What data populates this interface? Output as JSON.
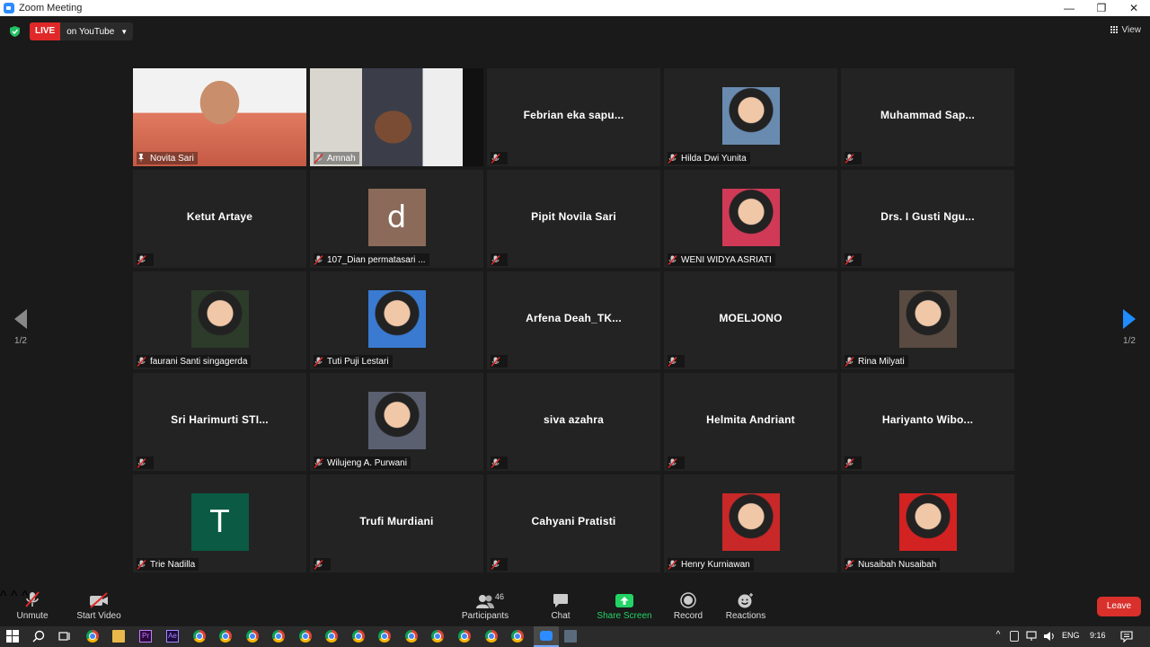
{
  "window": {
    "title": "Zoom Meeting"
  },
  "top": {
    "live_label": "LIVE",
    "live_target": "on YouTube",
    "view_label": "View"
  },
  "pagination": {
    "left": "1/2",
    "right": "1/2"
  },
  "tiles": [
    {
      "name": "Novita Sari",
      "display": "video",
      "active": true,
      "pinned": true
    },
    {
      "name": "Amnah",
      "display": "video"
    },
    {
      "name": "",
      "display": "name",
      "center_name": "Febrian  eka  sapu..."
    },
    {
      "name": "Hilda Dwi Yunita",
      "display": "photo"
    },
    {
      "name": "",
      "display": "name",
      "center_name": "Muhammad  Sap..."
    },
    {
      "name": "",
      "display": "name",
      "center_name": "Ketut Artaye"
    },
    {
      "name": "107_Dian permatasari ...",
      "display": "initial",
      "initial": "d",
      "initial_color": "#8b6a5a"
    },
    {
      "name": "",
      "display": "name",
      "center_name": "Pipit Novila Sari"
    },
    {
      "name": "WENI WIDYA ASRIATI",
      "display": "photo"
    },
    {
      "name": "",
      "display": "name",
      "center_name": "Drs.  I Gusti Ngu..."
    },
    {
      "name": "faurani Santi singagerda",
      "display": "photo"
    },
    {
      "name": "Tuti Puji Lestari",
      "display": "photo"
    },
    {
      "name": "",
      "display": "name",
      "center_name": "Arfena  Deah_TK..."
    },
    {
      "name": "",
      "display": "name",
      "center_name": "MOELJONO"
    },
    {
      "name": "Rina Milyati",
      "display": "photo"
    },
    {
      "name": "",
      "display": "name",
      "center_name": "Sri  Harimurti  STI..."
    },
    {
      "name": "Wilujeng A. Purwani",
      "display": "photo"
    },
    {
      "name": "",
      "display": "name",
      "center_name": "siva azahra"
    },
    {
      "name": "",
      "display": "name",
      "center_name": "Helmita Andriant"
    },
    {
      "name": "",
      "display": "name",
      "center_name": "Hariyanto  Wibo..."
    },
    {
      "name": "Trie Nadilla",
      "display": "initial",
      "initial": "T",
      "initial_color": "#0b5a43"
    },
    {
      "name": "",
      "display": "name",
      "center_name": "Trufi Murdiani"
    },
    {
      "name": "",
      "display": "name",
      "center_name": "Cahyani Pratisti"
    },
    {
      "name": "Henry Kurniawan",
      "display": "photo"
    },
    {
      "name": "Nusaibah Nusaibah",
      "display": "photo"
    }
  ],
  "toolbar": {
    "unmute": "Unmute",
    "start_video": "Start Video",
    "participants": "Participants",
    "participants_count": "46",
    "chat": "Chat",
    "share_screen": "Share Screen",
    "record": "Record",
    "reactions": "Reactions",
    "leave": "Leave"
  },
  "taskbar": {
    "language": "ENG",
    "time": "9:16"
  },
  "colors": {
    "live": "#e02828",
    "share": "#23d366",
    "leave": "#d9302c",
    "active_border": "#c3e05a",
    "nav_arrow": "#1f8cff"
  }
}
